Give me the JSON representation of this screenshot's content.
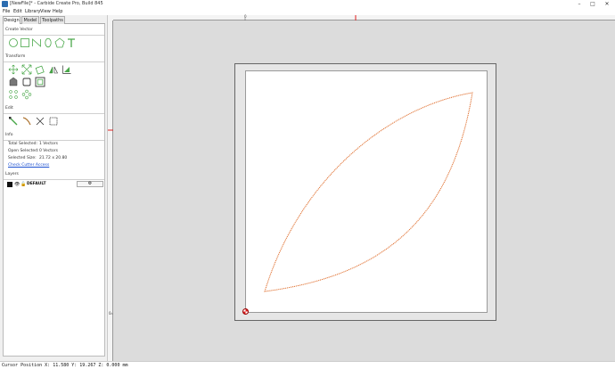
{
  "window": {
    "title": "[NewFile]* - Carbide Create Pro, Build 845",
    "controls": [
      "–",
      "□",
      "✕"
    ]
  },
  "menu": [
    "File",
    "Edit",
    "Library",
    "View",
    "Help"
  ],
  "tabs": [
    {
      "label": "Design",
      "active": true
    },
    {
      "label": "Model",
      "active": false
    },
    {
      "label": "Toolpaths",
      "active": false
    }
  ],
  "sections": {
    "create_vector": "Create Vector",
    "transform": "Transform",
    "edit": "Edit",
    "info": "Info",
    "layers": "Layers"
  },
  "info": {
    "total_selected_label": "Total Selected:",
    "total_selected_value": "1 Vectors",
    "open_selected_label": "Open Selected:",
    "open_selected_value": "0 Vectors",
    "selected_size_label": "Selected Size:",
    "selected_size_value": "21.72 x 20.80",
    "check_link": "Check Cutter Access"
  },
  "layers": {
    "name": "DEFAULT",
    "gear": "⚙",
    "add_label": "+"
  },
  "ruler": {
    "top_zero": "0",
    "left_zero": "0"
  },
  "colors": {
    "vector": "#e07030",
    "marker": "#e02020",
    "tool_green": "#4aa84a"
  },
  "status": {
    "text": "Cursor Position X: 11.580 Y: 19.267 Z: 0.000 mm"
  }
}
